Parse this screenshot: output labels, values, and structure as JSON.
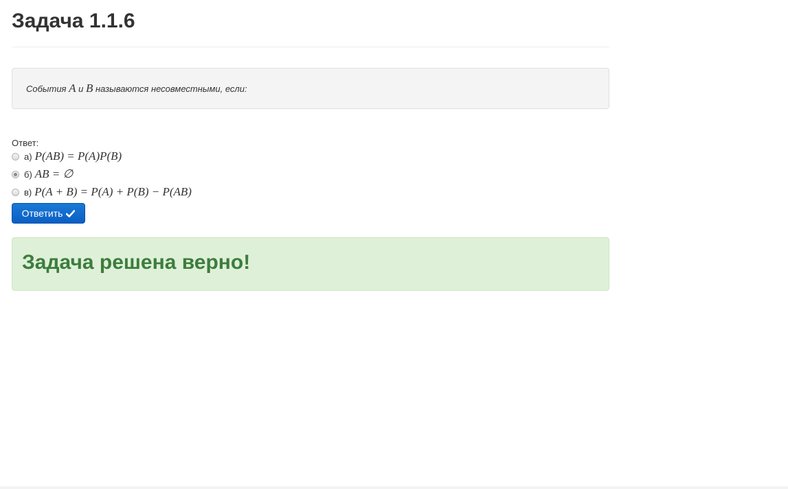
{
  "page": {
    "title": "Задача 1.1.6"
  },
  "problem": {
    "prefix": "События ",
    "var_a": "A",
    "middle": " и ",
    "var_b": "B",
    "suffix": " называются несовместными, если:"
  },
  "answer": {
    "label": "Ответ:",
    "options": [
      {
        "letter": "а)",
        "formula": "P(AB) = P(A)P(B)",
        "checked": false
      },
      {
        "letter": "б)",
        "formula": "AB = ∅",
        "checked": true
      },
      {
        "letter": "в)",
        "formula": "P(A + B) = P(A) + P(B) − P(AB)",
        "checked": false
      }
    ]
  },
  "submit": {
    "label": "Ответить",
    "icon": "check-icon"
  },
  "result": {
    "message": "Задача решена верно!",
    "color": "#3c7d3e",
    "background": "#dff0d8"
  }
}
